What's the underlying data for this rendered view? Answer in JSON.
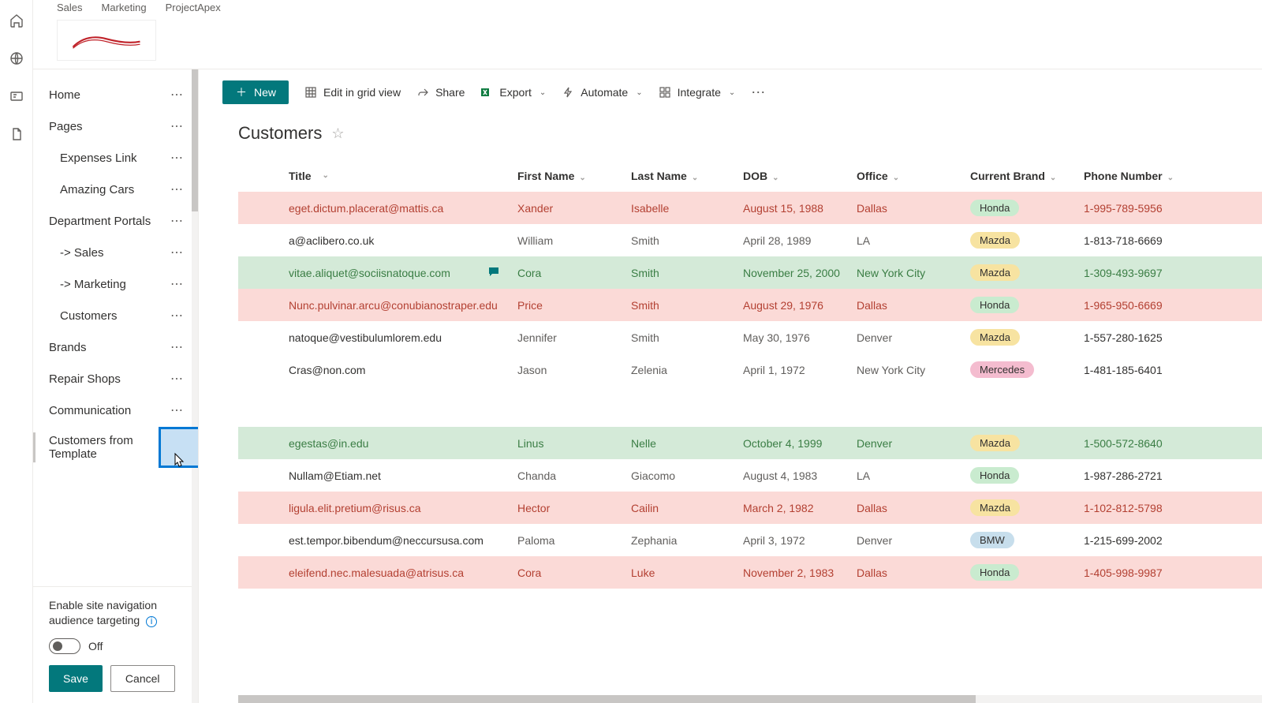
{
  "breadcrumb": [
    "Sales",
    "Marketing",
    "ProjectApex"
  ],
  "nav": {
    "items": [
      {
        "label": "Home",
        "sub": false
      },
      {
        "label": "Pages",
        "sub": false
      },
      {
        "label": "Expenses Link",
        "sub": true
      },
      {
        "label": "Amazing Cars",
        "sub": true
      },
      {
        "label": "Department Portals",
        "sub": false
      },
      {
        "label": "-> Sales",
        "sub": true
      },
      {
        "label": "-> Marketing",
        "sub": true
      },
      {
        "label": "Customers",
        "sub": true
      },
      {
        "label": "Brands",
        "sub": false
      },
      {
        "label": "Repair Shops",
        "sub": false
      },
      {
        "label": "Communication",
        "sub": false
      },
      {
        "label": "Customers from Template",
        "sub": false
      }
    ],
    "audience_label": "Enable site navigation audience targeting",
    "toggle_state": "Off",
    "save": "Save",
    "cancel": "Cancel"
  },
  "toolbar": {
    "new": "New",
    "edit": "Edit in grid view",
    "share": "Share",
    "export": "Export",
    "automate": "Automate",
    "integrate": "Integrate"
  },
  "list": {
    "title": "Customers",
    "columns": [
      "Title",
      "First Name",
      "Last Name",
      "DOB",
      "Office",
      "Current Brand",
      "Phone Number"
    ],
    "rows": [
      {
        "style": "pink",
        "title": "eget.dictum.placerat@mattis.ca",
        "first": "Xander",
        "last": "Isabelle",
        "dob": "August 15, 1988",
        "office": "Dallas",
        "brand": "Honda",
        "phone": "1-995-789-5956"
      },
      {
        "style": "plain",
        "title": "a@aclibero.co.uk",
        "first": "William",
        "last": "Smith",
        "dob": "April 28, 1989",
        "office": "LA",
        "brand": "Mazda",
        "phone": "1-813-718-6669"
      },
      {
        "style": "green",
        "title": "vitae.aliquet@sociisnatoque.com",
        "first": "Cora",
        "last": "Smith",
        "dob": "November 25, 2000",
        "office": "New York City",
        "brand": "Mazda",
        "phone": "1-309-493-9697",
        "comment": true
      },
      {
        "style": "pink",
        "title": "Nunc.pulvinar.arcu@conubianostraper.edu",
        "first": "Price",
        "last": "Smith",
        "dob": "August 29, 1976",
        "office": "Dallas",
        "brand": "Honda",
        "phone": "1-965-950-6669"
      },
      {
        "style": "plain",
        "title": "natoque@vestibulumlorem.edu",
        "first": "Jennifer",
        "last": "Smith",
        "dob": "May 30, 1976",
        "office": "Denver",
        "brand": "Mazda",
        "phone": "1-557-280-1625"
      },
      {
        "style": "plain",
        "title": "Cras@non.com",
        "first": "Jason",
        "last": "Zelenia",
        "dob": "April 1, 1972",
        "office": "New York City",
        "brand": "Mercedes",
        "phone": "1-481-185-6401"
      },
      {
        "style": "spacer"
      },
      {
        "style": "green",
        "title": "egestas@in.edu",
        "first": "Linus",
        "last": "Nelle",
        "dob": "October 4, 1999",
        "office": "Denver",
        "brand": "Mazda",
        "phone": "1-500-572-8640"
      },
      {
        "style": "plain",
        "title": "Nullam@Etiam.net",
        "first": "Chanda",
        "last": "Giacomo",
        "dob": "August 4, 1983",
        "office": "LA",
        "brand": "Honda",
        "phone": "1-987-286-2721"
      },
      {
        "style": "pink",
        "title": "ligula.elit.pretium@risus.ca",
        "first": "Hector",
        "last": "Cailin",
        "dob": "March 2, 1982",
        "office": "Dallas",
        "brand": "Mazda",
        "phone": "1-102-812-5798"
      },
      {
        "style": "plain",
        "title": "est.tempor.bibendum@neccursusa.com",
        "first": "Paloma",
        "last": "Zephania",
        "dob": "April 3, 1972",
        "office": "Denver",
        "brand": "BMW",
        "phone": "1-215-699-2002"
      },
      {
        "style": "pink",
        "title": "eleifend.nec.malesuada@atrisus.ca",
        "first": "Cora",
        "last": "Luke",
        "dob": "November 2, 1983",
        "office": "Dallas",
        "brand": "Honda",
        "phone": "1-405-998-9987"
      }
    ]
  },
  "brand_pills": {
    "Honda": "pill-honda",
    "Mazda": "pill-mazda",
    "Mercedes": "pill-mercedes",
    "BMW": "pill-bmw"
  }
}
